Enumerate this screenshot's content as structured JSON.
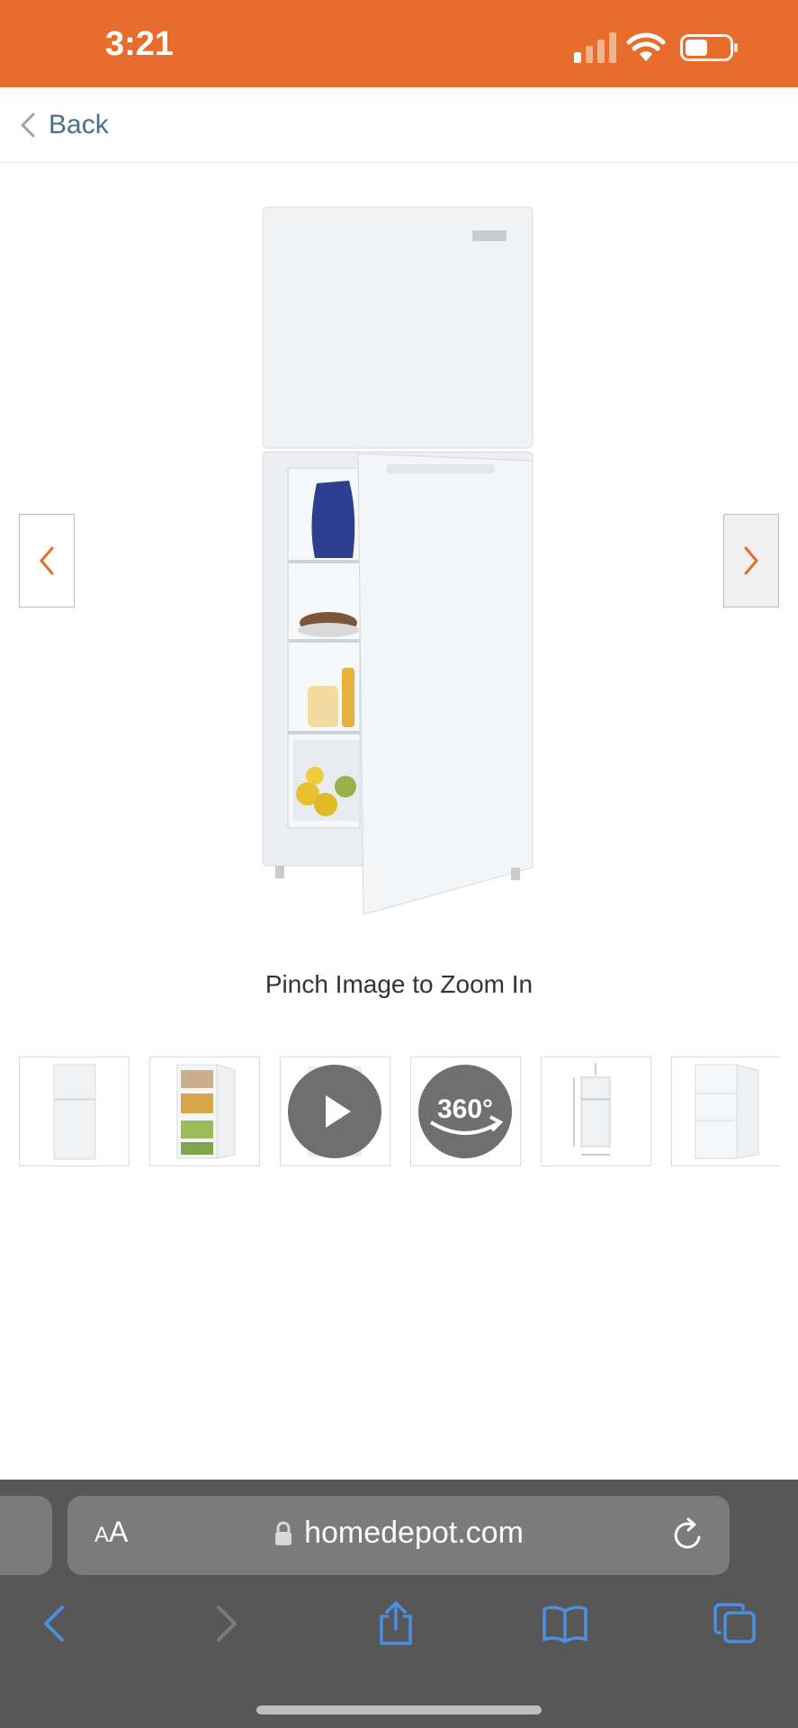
{
  "status_bar": {
    "time": "3:21",
    "signal_icon": "cellular-signal-icon",
    "wifi_icon": "wifi-icon",
    "battery_icon": "battery-icon"
  },
  "header": {
    "back_label": "Back",
    "back_icon": "chevron-left-icon"
  },
  "gallery": {
    "main_image": "refrigerator-door-open",
    "prev_icon": "chevron-left-icon",
    "next_icon": "chevron-right-icon",
    "zoom_hint": "Pinch Image to Zoom In",
    "thumbnails": [
      {
        "kind": "fridge-closed"
      },
      {
        "kind": "fridge-open-filled"
      },
      {
        "kind": "video",
        "icon": "play-icon"
      },
      {
        "kind": "360-view",
        "label": "360°"
      },
      {
        "kind": "dimensions"
      },
      {
        "kind": "fridge-open-empty"
      }
    ]
  },
  "browser": {
    "aa_large": "A",
    "aa_small": "A",
    "url": "homedepot.com",
    "lock_icon": "lock-icon",
    "reload_icon": "reload-icon",
    "toolbar": [
      "back-arrow-icon",
      "forward-arrow-icon",
      "share-icon",
      "bookmarks-icon",
      "tabs-icon"
    ]
  },
  "colors": {
    "brand": "#E86D2C",
    "link": "#4a6e8c",
    "browser_chrome": "#575757",
    "safari_blue": "#4a8fe0"
  }
}
